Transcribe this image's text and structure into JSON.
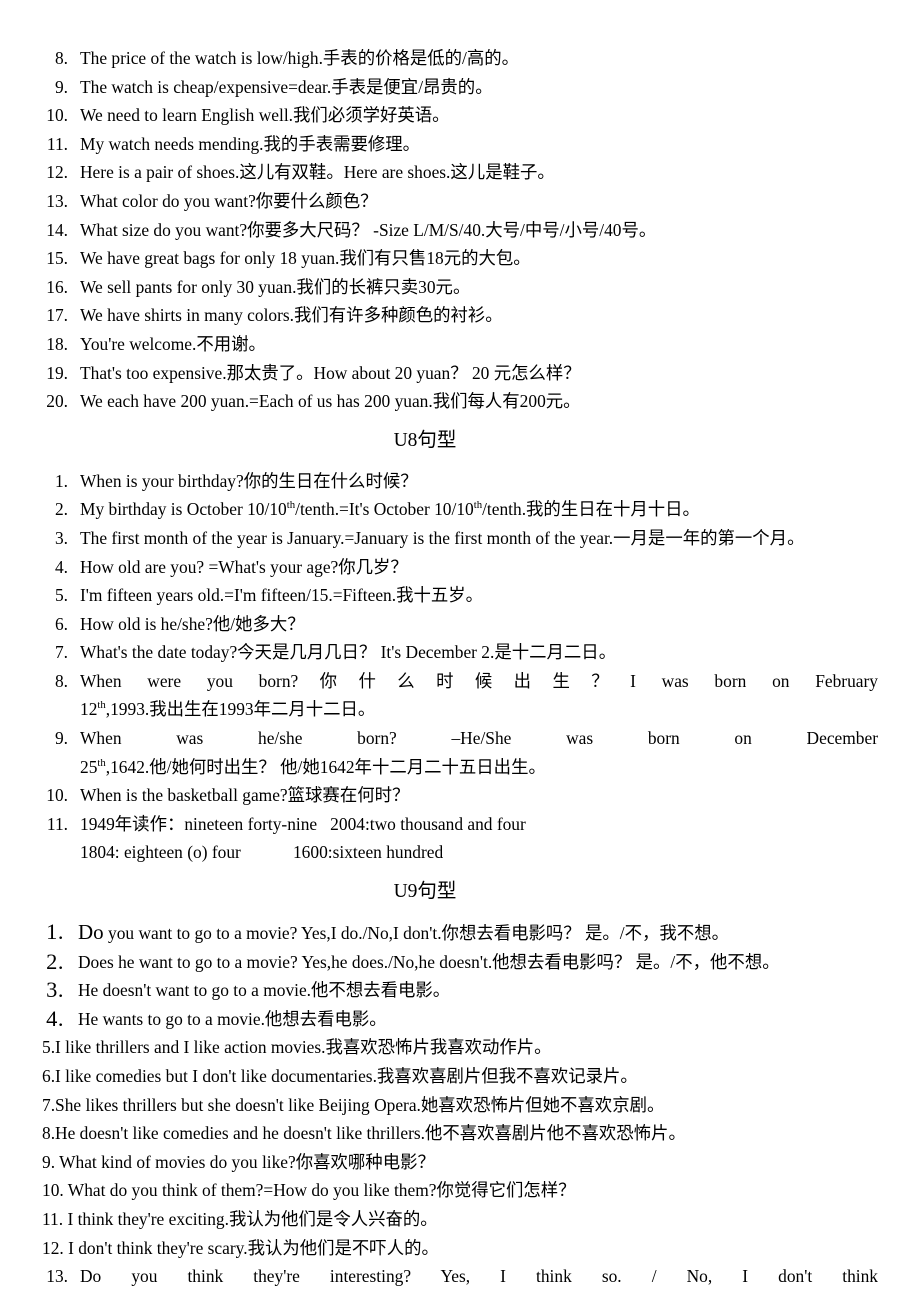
{
  "document": {
    "language_note": "English-Chinese bilingual sentence pattern study sheet"
  },
  "u7_continued": {
    "items": [
      {
        "num": "8.",
        "text": "The price of the watch is low/high.手表的价格是低的/高的。"
      },
      {
        "num": "9.",
        "text": "The watch is cheap/expensive=dear.手表是便宜/昂贵的。"
      },
      {
        "num": "10.",
        "text": "We need to learn English well.我们必须学好英语。"
      },
      {
        "num": "11.",
        "text": "My watch needs mending.我的手表需要修理。"
      },
      {
        "num": "12.",
        "text": "Here is a pair of shoes.这儿有双鞋。Here are shoes.这儿是鞋子。"
      },
      {
        "num": "13.",
        "text": "What color do you want?你要什么颜色？"
      },
      {
        "num": "14.",
        "text": "What size do you want?你要多大尺码？ -Size L/M/S/40.大号/中号/小号/40号。"
      },
      {
        "num": "15.",
        "text": "We have great bags for only 18 yuan.我们有只售18元的大包。"
      },
      {
        "num": "16.",
        "text": "We sell pants for only 30 yuan.我们的长裤只卖30元。"
      },
      {
        "num": "17.",
        "text": "We have shirts in many colors.我们有许多种颜色的衬衫。"
      },
      {
        "num": "18.",
        "text": "You're welcome.不用谢。"
      },
      {
        "num": "19.",
        "text": "That's too expensive.那太贵了。How about 20 yuan？ 20 元怎么样？"
      },
      {
        "num": "20.",
        "text": "We each have 200 yuan.=Each of us has 200 yuan.我们每人有200元。"
      }
    ]
  },
  "u8": {
    "heading": "U8句型",
    "items": [
      {
        "num": "1.",
        "text": "When is your birthday?你的生日在什么时候？"
      },
      {
        "num": "2.",
        "pre": "My birthday is October 10/10",
        "sup1": "th",
        "mid": "/tenth.=It's October 10/10",
        "sup2": "th",
        "post": "/tenth.我的生日在十月十日。"
      },
      {
        "num": "3.",
        "text": "The first month of the year is January.=January is the first month of the year.一月是一年的第一个月。"
      },
      {
        "num": "4.",
        "text": "How old are you? =What's your age?你几岁？"
      },
      {
        "num": "5.",
        "text": "I'm fifteen years old.=I'm fifteen/15.=Fifteen.我十五岁。"
      },
      {
        "num": "6.",
        "text": "How old is he/she?他/她多大？"
      },
      {
        "num": "7.",
        "text": "What's the date today?今天是几月几日？  It's December 2.是十二月二日。"
      },
      {
        "num": "8.",
        "justified_line": "When were you born?你什么时候出生？I was born on February",
        "tail_pre": "12",
        "tail_sup": "th",
        "tail_post": ",1993.我出生在1993年二月十二日。"
      },
      {
        "num": "9.",
        "justified_line": "When was he/she born? –He/She was born on December",
        "tail_pre": "25",
        "tail_sup": "th",
        "tail_post": ",1642.他/她何时出生？ 他/她1642年十二月二十五日出生。"
      },
      {
        "num": "10.",
        "text": "When is the basketball game?篮球赛在何时？"
      },
      {
        "num": "11.",
        "text": "1949年读作：nineteen forty-nine   2004:two thousand and four",
        "subline": "1804: eighteen (o) four            1600:sixteen hundred"
      }
    ]
  },
  "u9": {
    "heading": "U9句型",
    "items": [
      {
        "num": "1.",
        "style": "big",
        "lead": "Do",
        "text": " you want to go to a movie? Yes,I do./No,I don't.你想去看电影吗？ 是。/不，我不想。"
      },
      {
        "num": "2.",
        "style": "big",
        "text": "Does he want to go to a movie? Yes,he does./No,he doesn't.他想去看电影吗？ 是。/不，他不想。"
      },
      {
        "num": "3.",
        "style": "big",
        "text": "He doesn't want to go to a movie.他不想去看电影。"
      },
      {
        "num": "4.",
        "style": "big",
        "text": "He wants to go to a movie.他想去看电影。"
      },
      {
        "num": "5.",
        "style": "flush",
        "text": "I like thrillers and I like action movies.我喜欢恐怖片我喜欢动作片。"
      },
      {
        "num": "6.",
        "style": "flush",
        "text": "I like comedies but I don't like documentaries.我喜欢喜剧片但我不喜欢记录片。"
      },
      {
        "num": "7.",
        "style": "flush",
        "text": "She likes thrillers but she doesn't like Beijing Opera.她喜欢恐怖片但她不喜欢京剧。"
      },
      {
        "num": "8.",
        "style": "flush",
        "text": "He doesn't like comedies and he doesn't like thrillers.他不喜欢喜剧片他不喜欢恐怖片。"
      },
      {
        "num": "9.",
        "style": "tight",
        "text": " What kind of movies do you like?你喜欢哪种电影？"
      },
      {
        "num": "10.",
        "style": "tight",
        "text": " What do you think of them?=How do you like them?你觉得它们怎样？"
      },
      {
        "num": "11.",
        "style": "tight",
        "text": " I think they're exciting.我认为他们是令人兴奋的。"
      },
      {
        "num": "12.",
        "style": "tight",
        "text": " I don't think they're scary.我认为他们是不吓人的。"
      },
      {
        "num": "13.",
        "style": "justified",
        "text": "Do you think they're interesting? Yes, I think so. / No, I don't think"
      }
    ]
  }
}
